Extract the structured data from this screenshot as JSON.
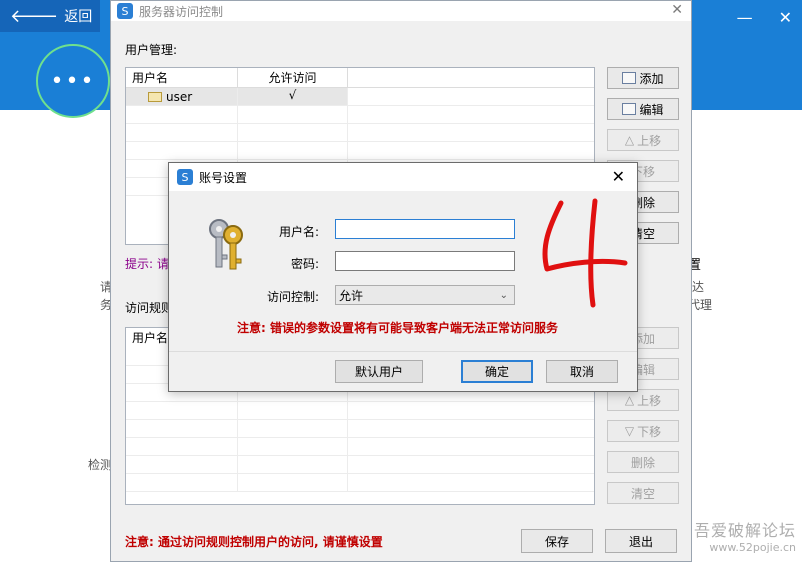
{
  "background": {
    "back_label": "返回",
    "circle_text": "•••",
    "fragments": [
      "置",
      "达",
      "代理",
      "请",
      "务",
      "检测"
    ]
  },
  "main_window": {
    "title": "服务器访问控制",
    "user_mgmt_label": "用户管理:",
    "user_table": {
      "headers": [
        "用户名",
        "允许访问"
      ],
      "rows": [
        {
          "name": "user",
          "allowed": "√"
        }
      ]
    },
    "user_buttons": [
      "添加",
      "编辑",
      "上移",
      "下移",
      "删除",
      "清空"
    ],
    "hint": "提示: 请",
    "rules_label": "访问规则",
    "rules_table": {
      "headers": [
        "用户名"
      ]
    },
    "rule_buttons": [
      "添加",
      "编辑",
      "上移",
      "下移",
      "删除",
      "清空"
    ],
    "bottom_warning": "注意: 通过访问规则控制用户的访问, 请谨慎设置",
    "save_label": "保存",
    "exit_label": "退出"
  },
  "dialog": {
    "title": "账号设置",
    "username_label": "用户名:",
    "username_value": "",
    "password_label": "密码:",
    "password_value": "",
    "access_label": "访问控制:",
    "access_value": "允许",
    "warning": "注意: 错误的参数设置将有可能导致客户端无法正常访问服务",
    "default_user_label": "默认用户",
    "ok_label": "确定",
    "cancel_label": "取消",
    "annotation": "4"
  },
  "watermark": {
    "line1": "吾爱破解论坛",
    "line2": "www.52pojie.cn"
  },
  "colors": {
    "accent": "#1a7fd6",
    "warning": "#c00000",
    "hint": "#8b008b"
  }
}
